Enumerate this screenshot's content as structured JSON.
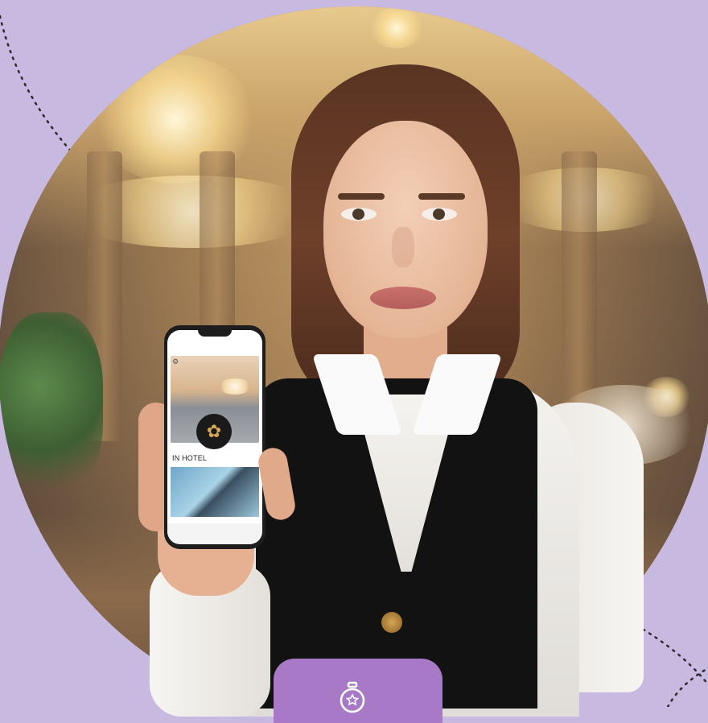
{
  "phone": {
    "screen_label": "IN HOTEL",
    "screen_top_icon": "settings-icon",
    "logo_icon": "lotus-icon"
  },
  "card": {
    "icon": "stopwatch-icon",
    "color": "#a779c6"
  },
  "colors": {
    "background": "#c8b9e1",
    "accent": "#a779c6"
  }
}
